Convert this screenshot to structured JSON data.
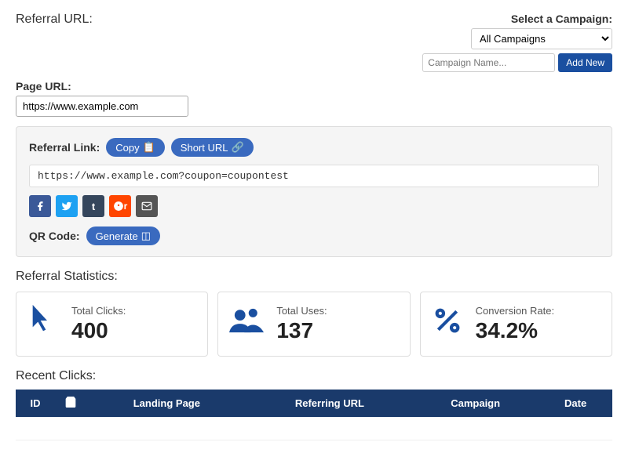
{
  "page": {
    "referral_url_title": "Referral URL:",
    "page_url_label": "Page URL:",
    "page_url_value": "https://www.example.com",
    "campaign_select_label": "Select a Campaign:",
    "campaign_select_option": "All Campaigns",
    "campaign_name_placeholder": "Campaign Name...",
    "add_new_label": "Add New",
    "referral_link_label": "Referral Link:",
    "copy_button_label": "Copy",
    "short_url_button_label": "Short URL",
    "referral_url_display": "https://www.example.com?coupon=coupontest",
    "qr_label": "QR Code:",
    "generate_label": "Generate",
    "stats_title": "Referral Statistics:",
    "recent_clicks_title": "Recent Clicks:",
    "stats": [
      {
        "icon": "cursor",
        "label": "Total Clicks:",
        "value": "400"
      },
      {
        "icon": "users",
        "label": "Total Uses:",
        "value": "137"
      },
      {
        "icon": "percent",
        "label": "Conversion Rate:",
        "value": "34.2%"
      }
    ],
    "table_headers": [
      "ID",
      "cart",
      "Landing Page",
      "Referring URL",
      "Campaign",
      "Date"
    ]
  }
}
